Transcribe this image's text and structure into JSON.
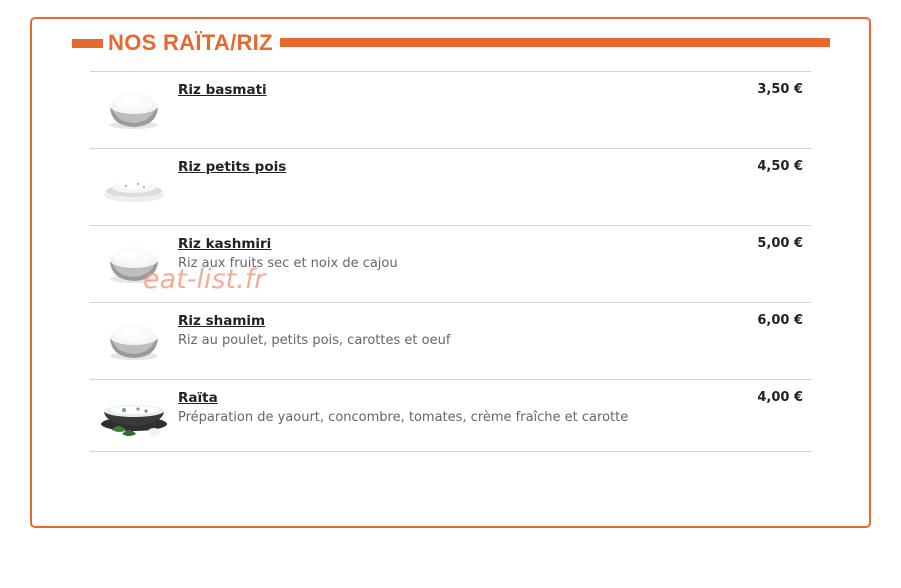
{
  "section": {
    "title": "NOS RAÏTA/RIZ"
  },
  "items": [
    {
      "name": "Riz basmati",
      "description": "",
      "price": "3,50 €",
      "image": "rice-bowl-image"
    },
    {
      "name": "Riz petits pois",
      "description": "",
      "price": "4,50 €",
      "image": "rice-plate-image"
    },
    {
      "name": "Riz kashmiri",
      "description": "Riz aux fruits sec et noix de cajou",
      "price": "5,00 €",
      "image": "rice-bowl-image"
    },
    {
      "name": "Riz shamim",
      "description": "Riz au poulet, petits pois, carottes et oeuf",
      "price": "6,00 €",
      "image": "rice-bowl-image"
    },
    {
      "name": "Raïta",
      "description": "Préparation de yaourt, concombre, tomates, crème fraîche et carotte",
      "price": "4,00 €",
      "image": "raita-bowl-image"
    }
  ],
  "watermark": "eat-list.fr",
  "colors": {
    "accent": "#e8692e",
    "divider": "#d5d5d5",
    "text": "#222222",
    "muted": "#666666"
  }
}
